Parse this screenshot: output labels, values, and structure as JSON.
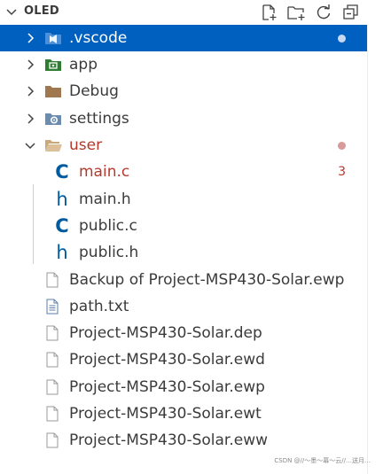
{
  "header": {
    "title": "OLED",
    "actions": [
      "new-file",
      "new-folder",
      "refresh",
      "collapse-all"
    ]
  },
  "tree": {
    "folders": [
      {
        "label": ".vscode",
        "color": "#ffffff"
      },
      {
        "label": "app",
        "color": "#3b3b3b"
      },
      {
        "label": "Debug",
        "color": "#3b3b3b"
      },
      {
        "label": "settings",
        "color": "#3b3b3b"
      },
      {
        "label": "user",
        "color": "#b5382c"
      }
    ],
    "user_children": [
      {
        "label": "main.c",
        "count": "3"
      },
      {
        "label": "main.h"
      },
      {
        "label": "public.c"
      },
      {
        "label": "public.h"
      }
    ],
    "root_files": [
      {
        "label": "Backup of Project-MSP430-Solar.ewp"
      },
      {
        "label": "path.txt"
      },
      {
        "label": "Project-MSP430-Solar.dep"
      },
      {
        "label": "Project-MSP430-Solar.ewd"
      },
      {
        "label": "Project-MSP430-Solar.ewp"
      },
      {
        "label": "Project-MSP430-Solar.ewt"
      },
      {
        "label": "Project-MSP430-Solar.eww"
      }
    ]
  },
  "colors": {
    "selection": "#0060c0",
    "error_text": "#b5382c",
    "c_icon": "#005a9e",
    "h_icon": "#005a9e",
    "folder_icon": "#a07850"
  },
  "watermark": "CSDN @//～墨～幕～云//…送月…"
}
